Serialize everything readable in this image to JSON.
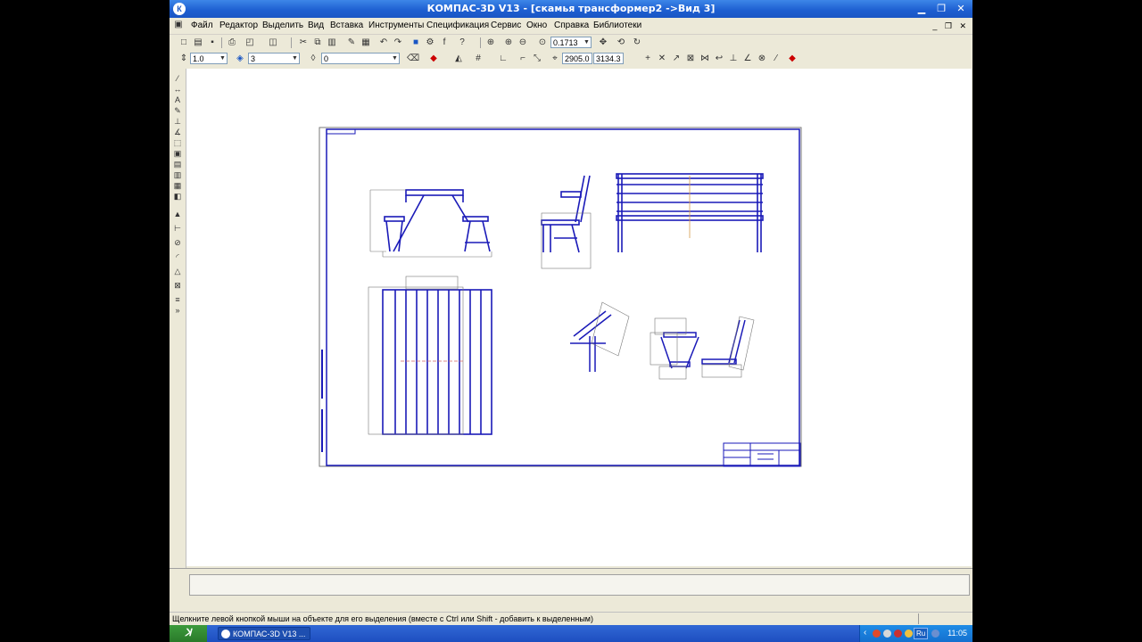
{
  "window": {
    "title": "КОМПАС-3D V13 - [скамья трансформер2 ->Вид 3]"
  },
  "menu": {
    "items": [
      "Файл",
      "Редактор",
      "Выделить",
      "Вид",
      "Вставка",
      "Инструменты",
      "Спецификация",
      "Сервис",
      "Окно",
      "Справка",
      "Библиотеки"
    ]
  },
  "toolbar1": {
    "zoom_value": "0.1713"
  },
  "toolbar2": {
    "step_value": "1.0",
    "layer_value": "3",
    "style_value": "0",
    "coord_x": "2905.0",
    "coord_y": "3134.3"
  },
  "status": {
    "hint": "Щелкните левой кнопкой мыши на объекте для его выделения (вместе с Ctrl или Shift - добавить к выделенным)"
  },
  "taskbar": {
    "task_label": "КОМПАС-3D V13 ...",
    "lang": "Ru",
    "clock": "11:05"
  },
  "colors": {
    "titlebar": "#1c5dd0",
    "drawing_lines": "#1a1ab8",
    "taskbar": "#245edb"
  }
}
